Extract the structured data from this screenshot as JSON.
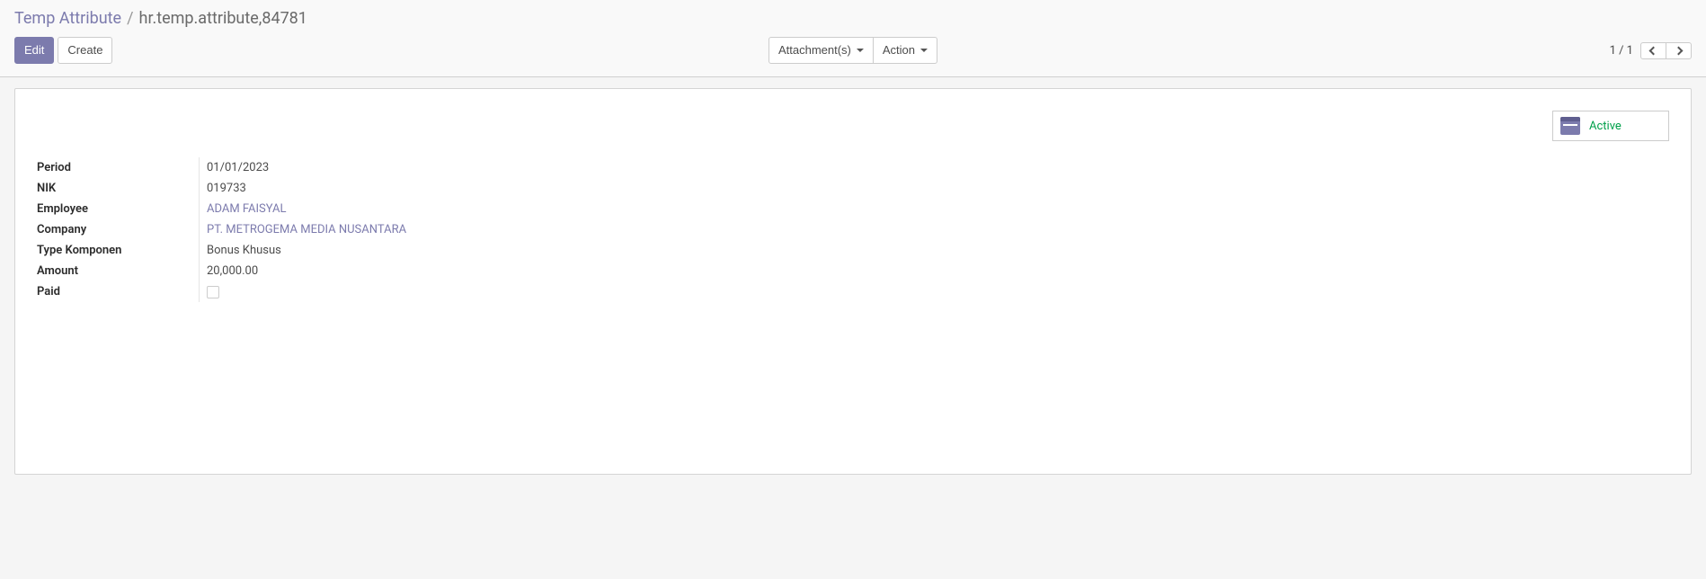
{
  "breadcrumb": {
    "parent": "Temp Attribute",
    "separator": "/",
    "current": "hr.temp.attribute,84781"
  },
  "buttons": {
    "edit": "Edit",
    "create": "Create",
    "attachments": "Attachment(s)",
    "action": "Action"
  },
  "pager": {
    "text": "1 / 1"
  },
  "status": {
    "active_label": "Active"
  },
  "fields": {
    "period": {
      "label": "Period",
      "value": "01/01/2023"
    },
    "nik": {
      "label": "NIK",
      "value": "019733"
    },
    "employee": {
      "label": "Employee",
      "value": "ADAM FAISYAL"
    },
    "company": {
      "label": "Company",
      "value": "PT. METROGEMA MEDIA NUSANTARA"
    },
    "type_komponen": {
      "label": "Type Komponen",
      "value": "Bonus Khusus"
    },
    "amount": {
      "label": "Amount",
      "value": "20,000.00"
    },
    "paid": {
      "label": "Paid",
      "checked": false
    }
  }
}
